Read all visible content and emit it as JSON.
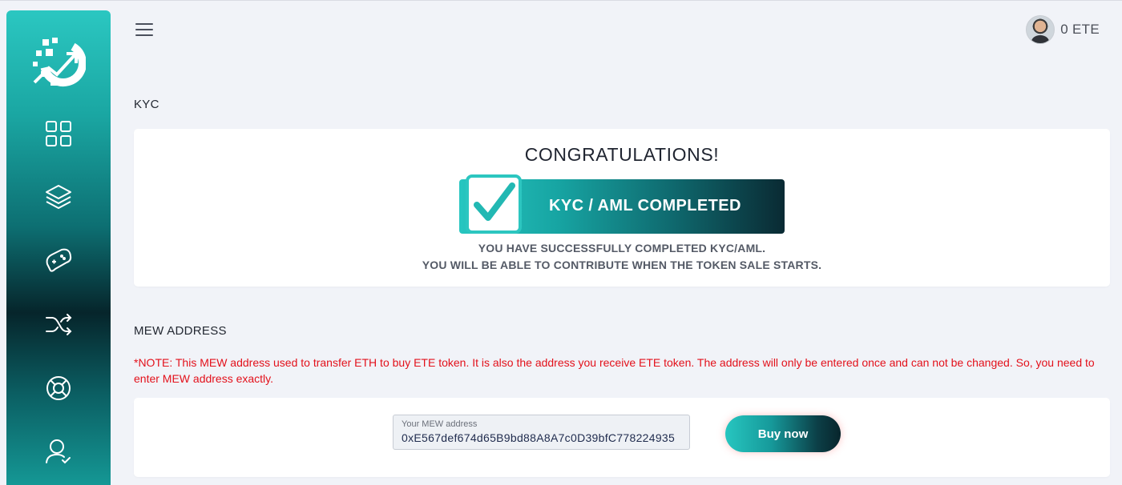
{
  "user": {
    "balance": "0 ETE"
  },
  "sidebar": {
    "items": [
      {
        "icon": "grid-icon"
      },
      {
        "icon": "layers-icon"
      },
      {
        "icon": "gamepad-icon"
      },
      {
        "icon": "shuffle-icon"
      },
      {
        "icon": "lifebuoy-icon"
      },
      {
        "icon": "user-icon"
      }
    ]
  },
  "kyc": {
    "title": "KYC",
    "congrats": "CONGRATULATIONS!",
    "badge": "KYC / AML COMPLETED",
    "message_line1": "YOU HAVE SUCCESSFULLY COMPLETED KYC/AML.",
    "message_line2": "YOU WILL BE ABLE TO CONTRIBUTE WHEN THE TOKEN SALE STARTS."
  },
  "mew": {
    "title": "MEW ADDRESS",
    "note": "*NOTE: This MEW address used to transfer ETH to buy ETE token. It is also the address you receive ETE token. The address will only be entered once and can not be changed. So, you need to enter MEW address exactly.",
    "field_label": "Your MEW address",
    "address": "0xE567def674d65B9bd88A8A7c0D39bfC778224935",
    "buy_label": "Buy now"
  },
  "colors": {
    "accent": "#2bc7c1",
    "dark": "#06252b",
    "note": "#e3111b",
    "background": "#f1f3f8"
  }
}
